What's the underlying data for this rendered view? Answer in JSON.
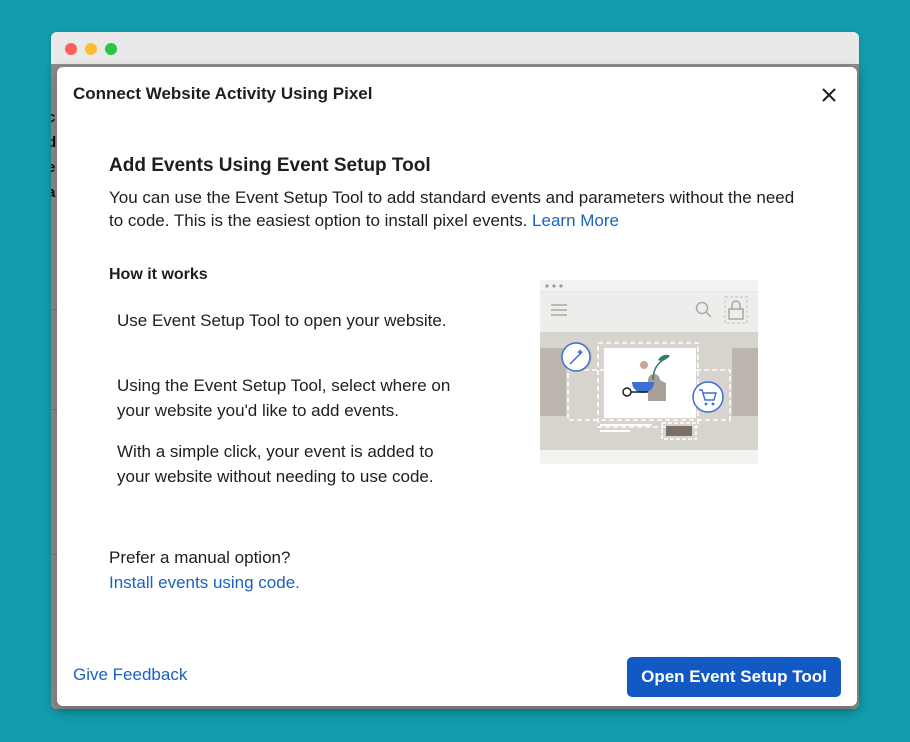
{
  "window": {
    "traffic_lights": [
      "close",
      "minimize",
      "zoom"
    ]
  },
  "background": {
    "fragments": [
      "c",
      "d",
      "e",
      "a"
    ]
  },
  "modal": {
    "title": "Connect Website Activity Using Pixel",
    "close_icon": "close-icon",
    "section_title": "Add Events Using Event Setup Tool",
    "intro_text": "You can use the Event Setup Tool to add standard events and parameters without the need to code. This is the easiest option to install pixel events.",
    "learn_more": "Learn More",
    "how_title": "How it works",
    "steps": [
      "Use Event Setup Tool to open your website.",
      "Using the Event Setup Tool, select where on your website you'd like to add events.",
      "With a simple click, your event is added to your website without needing to use code."
    ],
    "manual_prompt": "Prefer a manual option?",
    "manual_link": "Install events using code.",
    "feedback_link": "Give Feedback",
    "primary_button": "Open Event Setup Tool",
    "illustration_icons": [
      "menu-icon",
      "search-icon",
      "lock-icon",
      "magic-wand-icon",
      "cart-icon"
    ]
  },
  "colors": {
    "page_background": "#129cad",
    "link": "#1a62c2",
    "primary_button": "#1259c3"
  }
}
